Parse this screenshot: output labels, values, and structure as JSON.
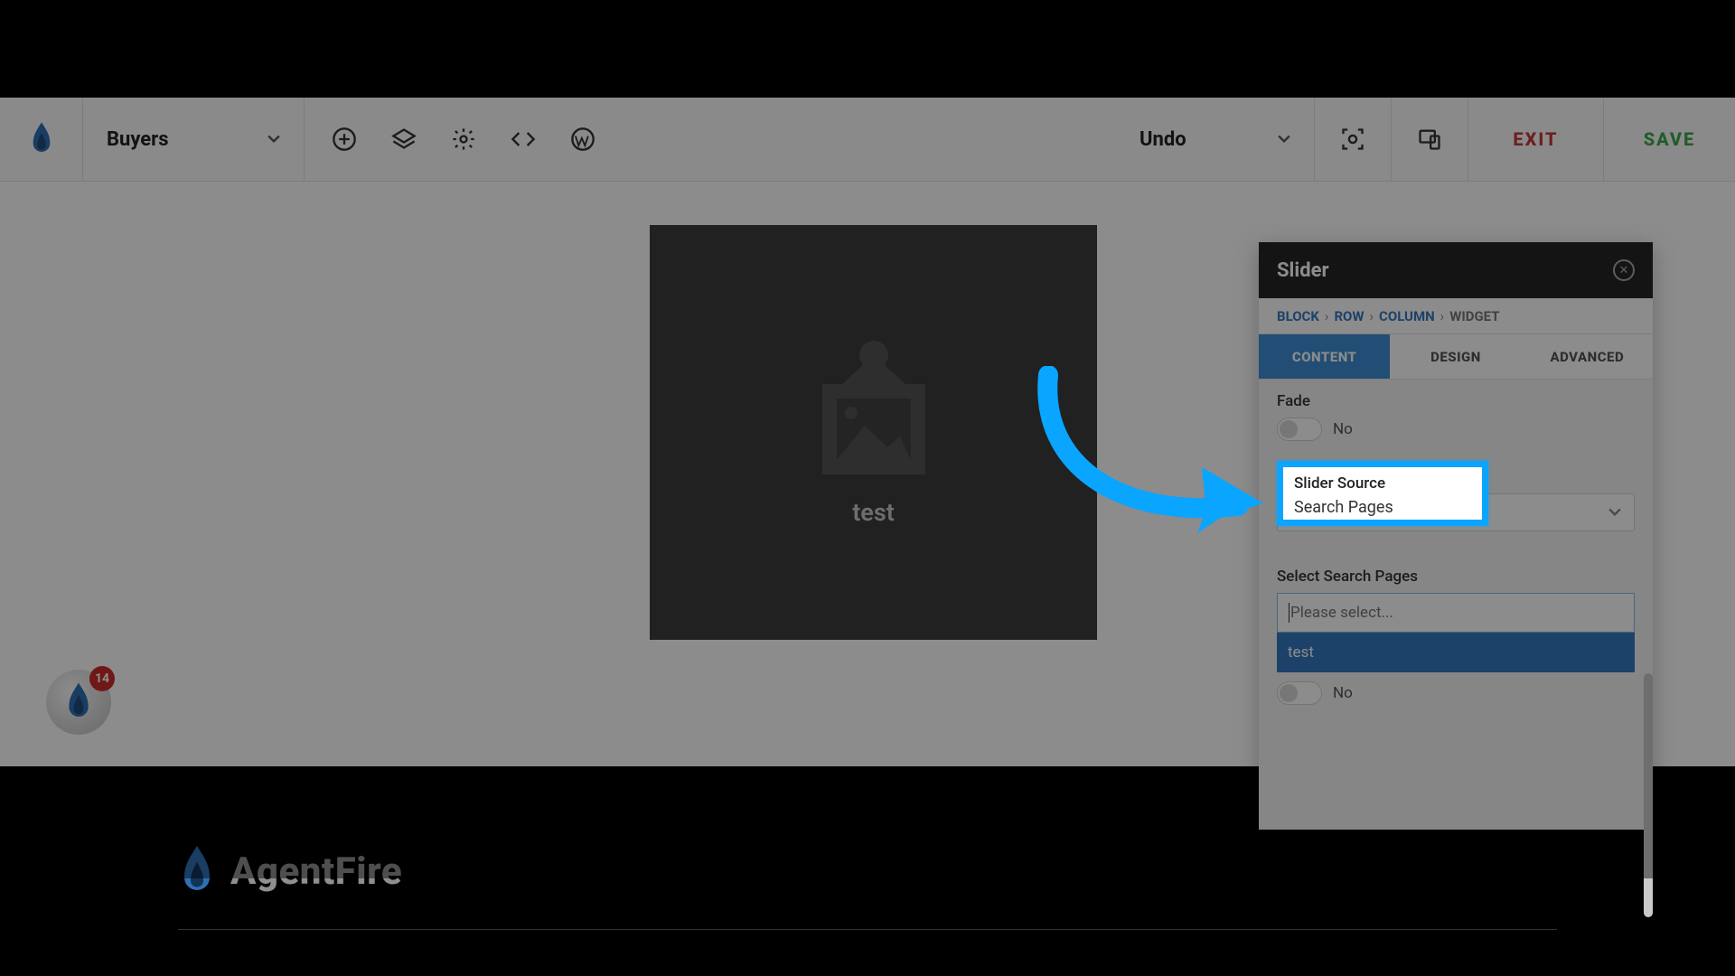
{
  "toolbar": {
    "page_name": "Buyers",
    "undo_label": "Undo",
    "exit_label": "EXIT",
    "save_label": "SAVE"
  },
  "preview": {
    "caption": "test"
  },
  "footer": {
    "brand": "AgentFire",
    "badge_count": "14"
  },
  "panel": {
    "title": "Slider",
    "breadcrumbs": {
      "block": "BLOCK",
      "row": "ROW",
      "column": "COLUMN",
      "widget": "WIDGET"
    },
    "tabs": {
      "content": "CONTENT",
      "design": "DESIGN",
      "advanced": "ADVANCED"
    },
    "fade_label": "Fade",
    "fade_value": "No",
    "slider_source_label": "Slider Source",
    "slider_source_value": "Search Pages",
    "select_pages_label": "Select Search Pages",
    "select_pages_placeholder": "Please select...",
    "select_pages_option": "test",
    "second_toggle_value": "No"
  }
}
